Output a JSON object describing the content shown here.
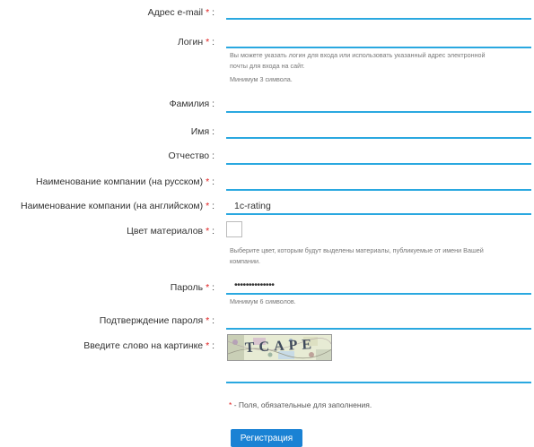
{
  "required_mark": "*",
  "colon": ":",
  "form": {
    "email_label": "Адрес e-mail",
    "login_label": "Логин",
    "login_hint_line1": "Вы можете указать логин для входа или использовать указанный адрес электронной",
    "login_hint_line2": "почты для входа на сайт.",
    "login_hint_line3": "Минимум 3 символа.",
    "lastname_label": "Фамилия",
    "firstname_label": "Имя",
    "middlename_label": "Отчество",
    "company_ru_label": "Наименование компании (на русском)",
    "company_en_label": "Наименование компании (на английском)",
    "company_en_value": "1c-rating",
    "color_label": "Цвет материалов",
    "color_hint_line1": "Выберите цвет, которым будут выделены материалы, публикуемые от имени Вашей",
    "color_hint_line2": "компании.",
    "password_label": "Пароль",
    "password_value": "••••••••••••••",
    "password_hint": "Минимум 6 символов.",
    "confirm_label": "Подтверждение пароля",
    "captcha_label": "Введите слово на картинке",
    "captcha_text": "TCAPE",
    "required_note": "- Поля, обязательные для заполнения.",
    "submit_label": "Регистрация"
  },
  "colors": {
    "accent": "#2aa8e0",
    "button": "#1a82d4",
    "required": "#e02020"
  }
}
